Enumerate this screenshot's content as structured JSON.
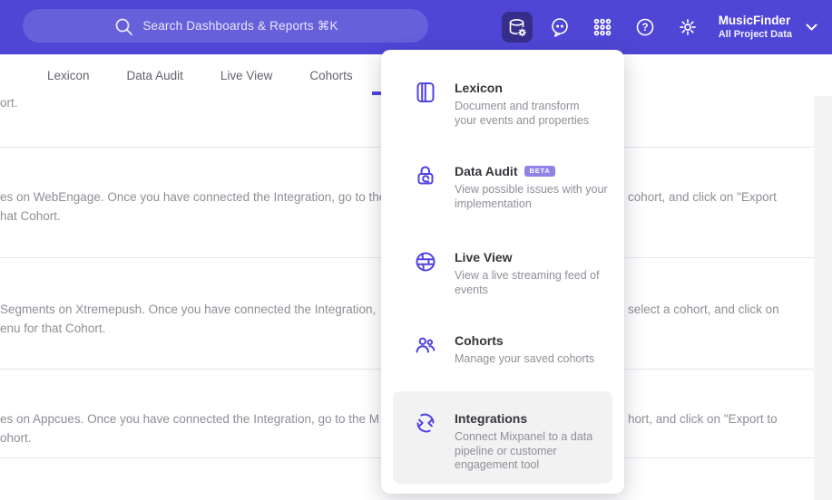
{
  "colors": {
    "header_bg": "#4f46d6",
    "accent": "#4f44e0",
    "active_icon_bg": "#372e8c",
    "badge_bg": "#8f83e8",
    "hover_item_bg": "#f2f2f3",
    "muted_text": "#8e8e96"
  },
  "header": {
    "search_placeholder": "Search Dashboards & Reports ⌘K",
    "project_name": "MusicFinder",
    "project_subtitle": "All Project Data",
    "icons": [
      "data-management-icon",
      "chat-feedback-icon",
      "apps-grid-icon",
      "help-icon",
      "settings-gear-icon",
      "chevron-down-icon"
    ]
  },
  "nav": {
    "tabs": [
      {
        "label": "Lexicon"
      },
      {
        "label": "Data Audit"
      },
      {
        "label": "Live View"
      },
      {
        "label": "Cohorts"
      }
    ]
  },
  "menu": {
    "items": [
      {
        "title": "Lexicon",
        "icon": "book-icon",
        "desc": "Document and transform\nyour events and properties"
      },
      {
        "title": "Data Audit",
        "icon": "lock-icon",
        "badge": "BETA",
        "desc": "View possible issues with your\nimplementation"
      },
      {
        "title": "Live View",
        "icon": "globe-icon",
        "desc": "View a live streaming feed of\nevents"
      },
      {
        "title": "Cohorts",
        "icon": "users-icon",
        "desc": "Manage your saved cohorts"
      },
      {
        "title": "Integrations",
        "icon": "sync-icon",
        "desc": "Connect Mixpanel to a data\npipeline or customer\nengagement tool"
      }
    ]
  },
  "rows": [
    {
      "left1": "ort."
    },
    {
      "left1": "es on WebEngage. Once you have connected the Integration, go to the",
      "left2": "hat Cohort.",
      "right1": "cohort, and click on \"Export"
    },
    {
      "left1": "Segments on Xtremepush. Once you have connected the Integration,",
      "left2": "enu for that Cohort.",
      "right1": "select a cohort, and click on"
    },
    {
      "left1": "es on Appcues. Once you have connected the Integration, go to the M",
      "left2": "ohort.",
      "right1": "hort, and click on \"Export to"
    }
  ]
}
